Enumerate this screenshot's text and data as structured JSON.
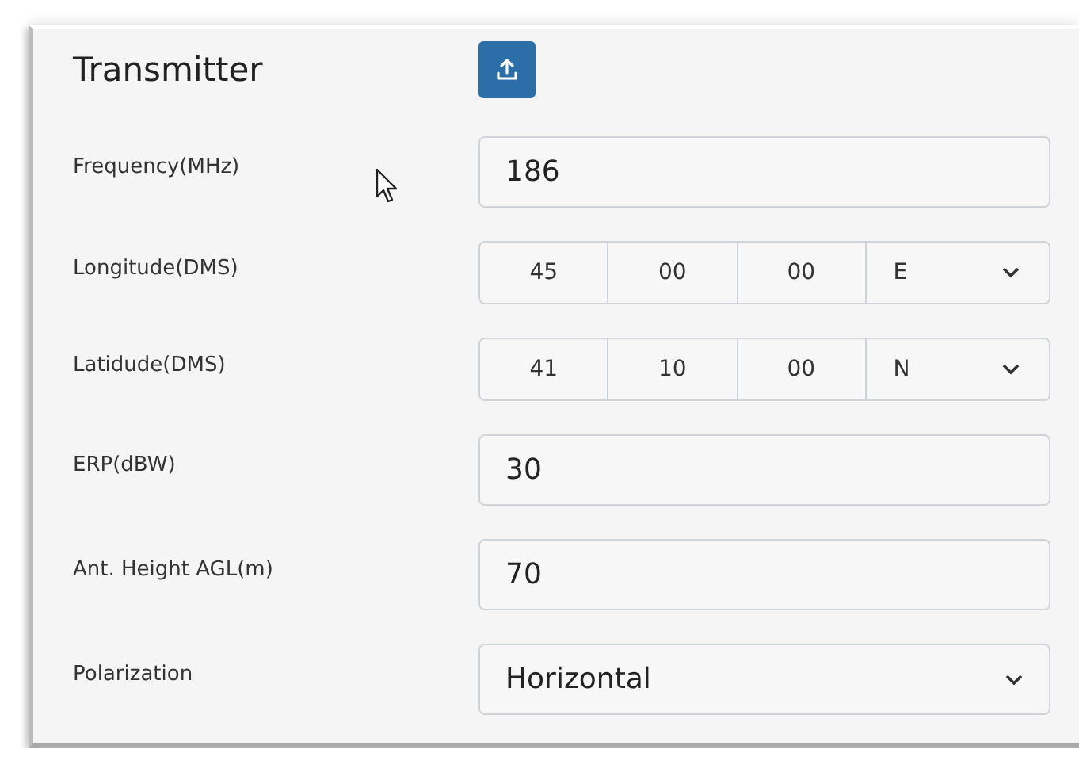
{
  "panel": {
    "title": "Transmitter"
  },
  "fields": [
    {
      "kind": "text",
      "label": "Frequency(MHz)",
      "value": "186"
    },
    {
      "kind": "dms",
      "label": "Longitude(DMS)",
      "parts": [
        "45",
        "00",
        "00"
      ],
      "hemisphere": "E"
    },
    {
      "kind": "dms",
      "label": "Latidude(DMS)",
      "parts": [
        "41",
        "10",
        "00"
      ],
      "hemisphere": "N"
    },
    {
      "kind": "text",
      "label": "ERP(dBW)",
      "value": "30"
    },
    {
      "kind": "text",
      "label": "Ant. Height AGL(m)",
      "value": "70"
    },
    {
      "kind": "select",
      "label": "Polarization",
      "value": "Horizontal"
    }
  ]
}
